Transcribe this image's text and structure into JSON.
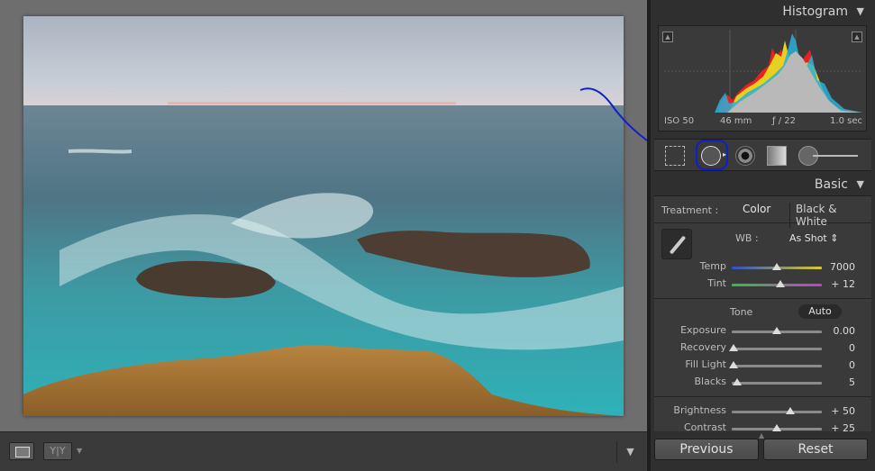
{
  "histogram": {
    "title": "Histogram",
    "iso": "ISO 50",
    "focal": "46 mm",
    "aperture": "ƒ / 22",
    "shutter": "1.0 sec"
  },
  "basic": {
    "title": "Basic",
    "treatment_label": "Treatment :",
    "treatment_color": "Color",
    "treatment_bw": "Black & White",
    "wb_label": "WB :",
    "wb_value": "As Shot ⇕",
    "temp_label": "Temp",
    "temp_value": "7000",
    "temp_level": 0.5,
    "tint_label": "Tint",
    "tint_value": "+ 12",
    "tint_level": 0.54,
    "tone_label": "Tone",
    "auto_label": "Auto",
    "exposure_label": "Exposure",
    "exposure_value": "0.00",
    "exposure_level": 0.5,
    "recovery_label": "Recovery",
    "recovery_value": "0",
    "recovery_level": 0.02,
    "filllight_label": "Fill Light",
    "filllight_value": "0",
    "filllight_level": 0.02,
    "blacks_label": "Blacks",
    "blacks_value": "5",
    "blacks_level": 0.06,
    "brightness_label": "Brightness",
    "brightness_value": "+ 50",
    "brightness_level": 0.65,
    "contrast_label": "Contrast",
    "contrast_value": "+ 25",
    "contrast_level": 0.5
  },
  "buttons": {
    "previous": "Previous",
    "reset": "Reset"
  },
  "toolbar": {
    "yy_label": "Y|Y"
  },
  "colors": {
    "accent_annotation": "#1020c8",
    "panel_bg": "#3a3a3a"
  }
}
